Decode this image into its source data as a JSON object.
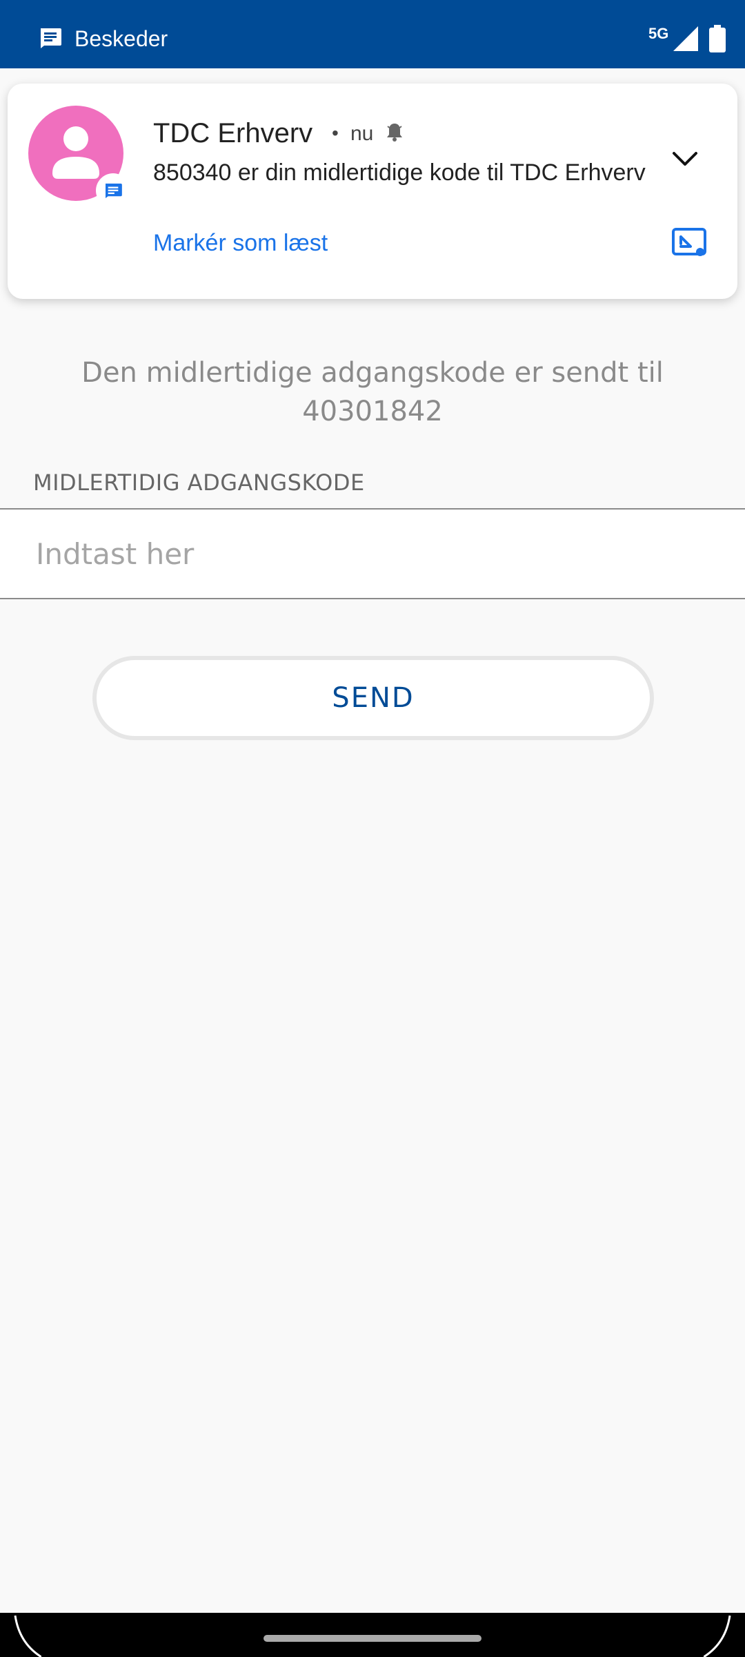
{
  "status_bar": {
    "app_name": "Beskeder",
    "network": "5G"
  },
  "page": {
    "info_text": "Den midlertidige adgangskode er sendt til 40301842",
    "field_label": "MIDLERTIDIG ADGANGSKODE",
    "input_placeholder": "Indtast her",
    "input_value": "",
    "send_label": "SEND"
  },
  "notification": {
    "sender": "TDC Erhverv",
    "separator": "•",
    "time": "nu",
    "body": "850340 er din midlertidige kode til TDC Erhverv",
    "action_label": "Markér som læst",
    "avatar_color": "#f06fbe",
    "action_color": "#1a73e8"
  },
  "colors": {
    "status_bar_bg": "#004b96",
    "send_text": "#004b96"
  },
  "icons": {
    "app": "message-icon",
    "signal": "signal-icon",
    "battery": "battery-icon",
    "bell": "bell-icon",
    "expand": "chevron-down-icon",
    "pip": "picture-in-picture-icon"
  }
}
